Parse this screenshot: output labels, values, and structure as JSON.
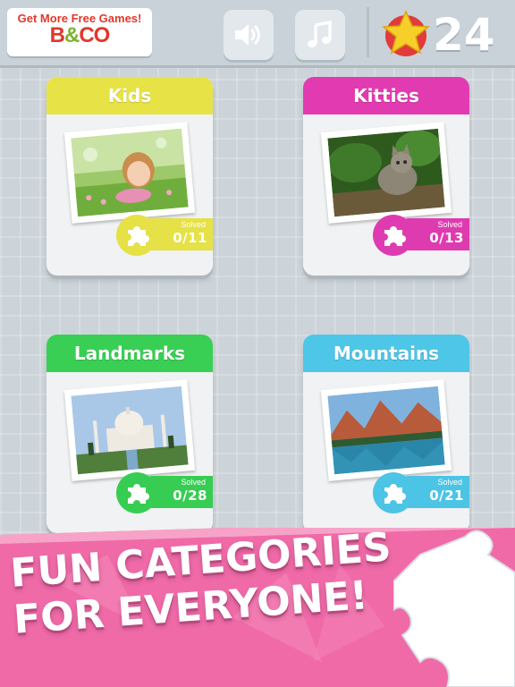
{
  "promo": {
    "line1": "Get More Free Games!",
    "logo_b": "B",
    "logo_amp": "&",
    "logo_co": "CO"
  },
  "toolbar": {
    "sound_icon": "speaker-icon",
    "music_icon": "music-note-icon"
  },
  "stars": {
    "icon": "star-icon",
    "count": "24"
  },
  "categories": [
    {
      "name": "Kids",
      "solved_label": "Solved",
      "solved": "0/11",
      "color": "#e7e347"
    },
    {
      "name": "Kitties",
      "solved_label": "Solved",
      "solved": "0/13",
      "color": "#e23bb2"
    },
    {
      "name": "Landmarks",
      "solved_label": "Solved",
      "solved": "0/28",
      "color": "#39cf54"
    },
    {
      "name": "Mountains",
      "solved_label": "Solved",
      "solved": "0/21",
      "color": "#4ec6e7"
    }
  ],
  "banner": {
    "line1": "FUN CATEGORIES",
    "line2": "FOR EVERYONE!",
    "color": "#f06aa8"
  }
}
